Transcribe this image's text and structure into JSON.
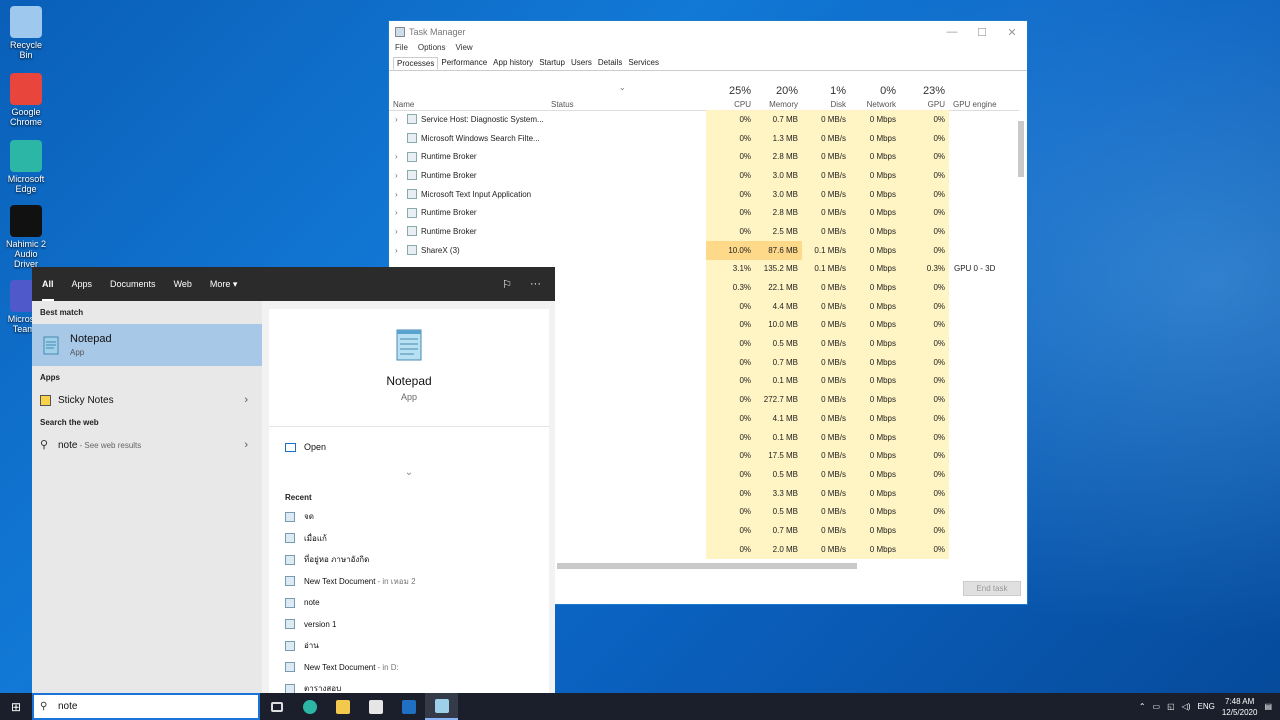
{
  "desktop": {
    "icons": [
      {
        "label": "Recycle Bin",
        "icon": "recycle-bin-icon",
        "color": "#9ec8ee"
      },
      {
        "label": "Google Chrome",
        "icon": "chrome-icon",
        "color": "#e8453c"
      },
      {
        "label": "Microsoft Edge",
        "icon": "edge-icon",
        "color": "#2cb6a6"
      },
      {
        "label": "Nahimic 2 Audio Driver",
        "icon": "nahimic-icon",
        "color": "#111111"
      },
      {
        "label": "Microsoft Teams",
        "icon": "teams-icon",
        "color": "#5059c9"
      }
    ]
  },
  "task_manager": {
    "title": "Task Manager",
    "window_controls": {
      "minimize": "—",
      "maximize": "☐",
      "close": "✕"
    },
    "menu": [
      "File",
      "Options",
      "View"
    ],
    "tabs": [
      "Processes",
      "Performance",
      "App history",
      "Startup",
      "Users",
      "Details",
      "Services"
    ],
    "active_tab": "Processes",
    "columns": {
      "name": "Name",
      "status": "Status",
      "cpu": {
        "pct": "25%",
        "label": "CPU"
      },
      "memory": {
        "pct": "20%",
        "label": "Memory"
      },
      "disk": {
        "pct": "1%",
        "label": "Disk"
      },
      "network": {
        "pct": "0%",
        "label": "Network"
      },
      "gpu": {
        "pct": "23%",
        "label": "GPU"
      },
      "gpu_engine": "GPU engine"
    },
    "sort_arrow": "⌄",
    "rows": [
      {
        "name": "Service Host: Diagnostic System...",
        "cpu": "0%",
        "mem": "0.7 MB",
        "disk": "0 MB/s",
        "net": "0 Mbps",
        "gpu": "0%",
        "eng": "",
        "expand": true
      },
      {
        "name": "Microsoft Windows Search Filte...",
        "cpu": "0%",
        "mem": "1.3 MB",
        "disk": "0 MB/s",
        "net": "0 Mbps",
        "gpu": "0%",
        "eng": "",
        "expand": false
      },
      {
        "name": "Runtime Broker",
        "cpu": "0%",
        "mem": "2.8 MB",
        "disk": "0 MB/s",
        "net": "0 Mbps",
        "gpu": "0%",
        "eng": "",
        "expand": true
      },
      {
        "name": "Runtime Broker",
        "cpu": "0%",
        "mem": "3.0 MB",
        "disk": "0 MB/s",
        "net": "0 Mbps",
        "gpu": "0%",
        "eng": "",
        "expand": true
      },
      {
        "name": "Microsoft Text Input Application",
        "cpu": "0%",
        "mem": "3.0 MB",
        "disk": "0 MB/s",
        "net": "0 Mbps",
        "gpu": "0%",
        "eng": "",
        "expand": true
      },
      {
        "name": "Runtime Broker",
        "cpu": "0%",
        "mem": "2.8 MB",
        "disk": "0 MB/s",
        "net": "0 Mbps",
        "gpu": "0%",
        "eng": "",
        "expand": true
      },
      {
        "name": "Runtime Broker",
        "cpu": "0%",
        "mem": "2.5 MB",
        "disk": "0 MB/s",
        "net": "0 Mbps",
        "gpu": "0%",
        "eng": "",
        "expand": true
      },
      {
        "name": "ShareX (3)",
        "cpu": "10.0%",
        "mem": "87.6 MB",
        "disk": "0.1 MB/s",
        "net": "0 Mbps",
        "gpu": "0%",
        "eng": "",
        "expand": true,
        "hot": true
      },
      {
        "name": "",
        "cpu": "3.1%",
        "mem": "135.2 MB",
        "disk": "0.1 MB/s",
        "net": "0 Mbps",
        "gpu": "0.3%",
        "eng": "GPU 0 - 3D",
        "expand": false
      },
      {
        "name": "",
        "cpu": "0.3%",
        "mem": "22.1 MB",
        "disk": "0 MB/s",
        "net": "0 Mbps",
        "gpu": "0%",
        "eng": "",
        "expand": false
      },
      {
        "name": "",
        "cpu": "0%",
        "mem": "4.4 MB",
        "disk": "0 MB/s",
        "net": "0 Mbps",
        "gpu": "0%",
        "eng": "",
        "expand": false
      },
      {
        "name": "",
        "cpu": "0%",
        "mem": "10.0 MB",
        "disk": "0 MB/s",
        "net": "0 Mbps",
        "gpu": "0%",
        "eng": "",
        "expand": false
      },
      {
        "name": "",
        "cpu": "0%",
        "mem": "0.5 MB",
        "disk": "0 MB/s",
        "net": "0 Mbps",
        "gpu": "0%",
        "eng": "",
        "expand": false
      },
      {
        "name": "",
        "cpu": "0%",
        "mem": "0.7 MB",
        "disk": "0 MB/s",
        "net": "0 Mbps",
        "gpu": "0%",
        "eng": "",
        "expand": false
      },
      {
        "name": "",
        "cpu": "0%",
        "mem": "0.1 MB",
        "disk": "0 MB/s",
        "net": "0 Mbps",
        "gpu": "0%",
        "eng": "",
        "expand": false
      },
      {
        "name": "",
        "cpu": "0%",
        "mem": "272.7 MB",
        "disk": "0 MB/s",
        "net": "0 Mbps",
        "gpu": "0%",
        "eng": "",
        "expand": false
      },
      {
        "name": "",
        "cpu": "0%",
        "mem": "4.1 MB",
        "disk": "0 MB/s",
        "net": "0 Mbps",
        "gpu": "0%",
        "eng": "",
        "expand": false
      },
      {
        "name": "",
        "cpu": "0%",
        "mem": "0.1 MB",
        "disk": "0 MB/s",
        "net": "0 Mbps",
        "gpu": "0%",
        "eng": "",
        "expand": false
      },
      {
        "name": "",
        "cpu": "0%",
        "mem": "17.5 MB",
        "disk": "0 MB/s",
        "net": "0 Mbps",
        "gpu": "0%",
        "eng": "",
        "expand": false
      },
      {
        "name": "",
        "cpu": "0%",
        "mem": "0.5 MB",
        "disk": "0 MB/s",
        "net": "0 Mbps",
        "gpu": "0%",
        "eng": "",
        "expand": false
      },
      {
        "name": "",
        "cpu": "0%",
        "mem": "3.3 MB",
        "disk": "0 MB/s",
        "net": "0 Mbps",
        "gpu": "0%",
        "eng": "",
        "expand": false
      },
      {
        "name": "",
        "cpu": "0%",
        "mem": "0.5 MB",
        "disk": "0 MB/s",
        "net": "0 Mbps",
        "gpu": "0%",
        "eng": "",
        "expand": false
      },
      {
        "name": "",
        "cpu": "0%",
        "mem": "0.7 MB",
        "disk": "0 MB/s",
        "net": "0 Mbps",
        "gpu": "0%",
        "eng": "",
        "expand": false
      },
      {
        "name": "",
        "cpu": "0%",
        "mem": "2.0 MB",
        "disk": "0 MB/s",
        "net": "0 Mbps",
        "gpu": "0%",
        "eng": "",
        "expand": false
      }
    ],
    "end_task": "End task"
  },
  "search_panel": {
    "tabs": [
      "All",
      "Apps",
      "Documents",
      "Web",
      "More ▾"
    ],
    "active_tab": "All",
    "best_match_header": "Best match",
    "best_match": {
      "title": "Notepad",
      "type": "App"
    },
    "apps_header": "Apps",
    "apps": [
      {
        "label": "Sticky Notes"
      }
    ],
    "web_header": "Search the web",
    "web_item": {
      "query": "note",
      "sub": "- See web results"
    },
    "detail": {
      "title": "Notepad",
      "type": "App",
      "open_label": "Open",
      "recent_header": "Recent"
    },
    "recent": [
      {
        "name": "จด",
        "loc": ""
      },
      {
        "name": "เมื่อแก้",
        "loc": ""
      },
      {
        "name": "ที่อยู่หอ ภาษาอังกิด",
        "loc": ""
      },
      {
        "name": "New Text Document",
        "loc": "- in เหอม 2"
      },
      {
        "name": "note",
        "loc": ""
      },
      {
        "name": "version 1",
        "loc": ""
      },
      {
        "name": "อ่าน",
        "loc": ""
      },
      {
        "name": "New Text Document",
        "loc": "- in D:"
      },
      {
        "name": "ตารางสอบ",
        "loc": ""
      }
    ]
  },
  "taskbar": {
    "search_text": "note",
    "tray": {
      "lang": "ENG",
      "time": "7:48 AM",
      "date": "12/5/2020"
    }
  }
}
